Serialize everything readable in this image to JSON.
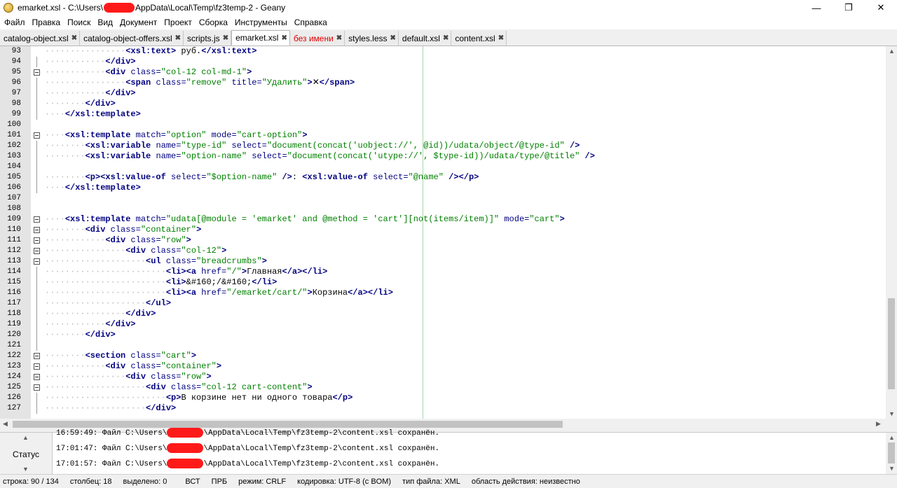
{
  "window": {
    "title_prefix": "emarket.xsl - C:\\Users\\",
    "title_suffix": "AppData\\Local\\Temp\\fz3temp-2 - Geany",
    "minimize": "—",
    "maximize": "❐",
    "close": "✕"
  },
  "menu": [
    "Файл",
    "Правка",
    "Поиск",
    "Вид",
    "Документ",
    "Проект",
    "Сборка",
    "Инструменты",
    "Справка"
  ],
  "tabs": [
    {
      "label": "catalog-object.xsl",
      "active": false,
      "unsaved": false
    },
    {
      "label": "catalog-object-offers.xsl",
      "active": false,
      "unsaved": false
    },
    {
      "label": "scripts.js",
      "active": false,
      "unsaved": false
    },
    {
      "label": "emarket.xsl",
      "active": true,
      "unsaved": false
    },
    {
      "label": "без имени",
      "active": false,
      "unsaved": true
    },
    {
      "label": "styles.less",
      "active": false,
      "unsaved": false
    },
    {
      "label": "default.xsl",
      "active": false,
      "unsaved": false
    },
    {
      "label": "content.xsl",
      "active": false,
      "unsaved": false
    }
  ],
  "editor": {
    "lines": [
      {
        "n": "93",
        "fold": "",
        "indent": 4,
        "code": [
          [
            "t",
            "<xsl:text>"
          ],
          [
            "x",
            " руб."
          ],
          [
            "t",
            "</xsl:text>"
          ]
        ]
      },
      {
        "n": "94",
        "fold": "line",
        "indent": 3,
        "code": [
          [
            "t",
            "</div>"
          ]
        ]
      },
      {
        "n": "95",
        "fold": "box",
        "indent": 3,
        "code": [
          [
            "t",
            "<div "
          ],
          [
            "a",
            "class="
          ],
          [
            "s",
            "\"col-12 col-md-1\""
          ],
          [
            "t",
            ">"
          ]
        ]
      },
      {
        "n": "96",
        "fold": "line",
        "indent": 4,
        "code": [
          [
            "t",
            "<span "
          ],
          [
            "a",
            "class="
          ],
          [
            "s",
            "\"remove\""
          ],
          [
            "a",
            " title="
          ],
          [
            "s",
            "\"Удалить\""
          ],
          [
            "t",
            ">"
          ],
          [
            "x",
            "✕"
          ],
          [
            "t",
            "</span>"
          ]
        ]
      },
      {
        "n": "97",
        "fold": "line",
        "indent": 3,
        "code": [
          [
            "t",
            "</div>"
          ]
        ]
      },
      {
        "n": "98",
        "fold": "line",
        "indent": 2,
        "code": [
          [
            "t",
            "</div>"
          ]
        ]
      },
      {
        "n": "99",
        "fold": "line",
        "indent": 1,
        "code": [
          [
            "t",
            "</xsl:template>"
          ]
        ]
      },
      {
        "n": "100",
        "fold": "",
        "indent": 0,
        "code": []
      },
      {
        "n": "101",
        "fold": "box",
        "indent": 1,
        "code": [
          [
            "t",
            "<xsl:template "
          ],
          [
            "a",
            "match="
          ],
          [
            "s",
            "\"option\""
          ],
          [
            "a",
            " mode="
          ],
          [
            "s",
            "\"cart-option\""
          ],
          [
            "t",
            ">"
          ]
        ]
      },
      {
        "n": "102",
        "fold": "line",
        "indent": 2,
        "code": [
          [
            "t",
            "<xsl:variable "
          ],
          [
            "a",
            "name="
          ],
          [
            "s",
            "\"type-id\""
          ],
          [
            "a",
            " select="
          ],
          [
            "s",
            "\"document(concat('uobject://', @id))/udata/object/@type-id\""
          ],
          [
            "t",
            " />"
          ]
        ]
      },
      {
        "n": "103",
        "fold": "line",
        "indent": 2,
        "code": [
          [
            "t",
            "<xsl:variable "
          ],
          [
            "a",
            "name="
          ],
          [
            "s",
            "\"option-name\""
          ],
          [
            "a",
            " select="
          ],
          [
            "s",
            "\"document(concat('utype://', $type-id))/udata/type/@title\""
          ],
          [
            "t",
            " />"
          ]
        ]
      },
      {
        "n": "104",
        "fold": "line",
        "indent": 0,
        "code": []
      },
      {
        "n": "105",
        "fold": "line",
        "indent": 2,
        "code": [
          [
            "t",
            "<p><xsl:value-of "
          ],
          [
            "a",
            "select="
          ],
          [
            "s",
            "\"$option-name\""
          ],
          [
            "t",
            " />"
          ],
          [
            "x",
            ": "
          ],
          [
            "t",
            "<xsl:value-of "
          ],
          [
            "a",
            "select="
          ],
          [
            "s",
            "\"@name\""
          ],
          [
            "t",
            " /></p>"
          ]
        ]
      },
      {
        "n": "106",
        "fold": "line",
        "indent": 1,
        "code": [
          [
            "t",
            "</xsl:template>"
          ]
        ]
      },
      {
        "n": "107",
        "fold": "",
        "indent": 0,
        "code": []
      },
      {
        "n": "108",
        "fold": "",
        "indent": 0,
        "code": []
      },
      {
        "n": "109",
        "fold": "box",
        "indent": 1,
        "code": [
          [
            "t",
            "<xsl:template "
          ],
          [
            "a",
            "match="
          ],
          [
            "s",
            "\"udata[@module = 'emarket' and @method = 'cart'][not(items/item)]\""
          ],
          [
            "a",
            " mode="
          ],
          [
            "s",
            "\"cart\""
          ],
          [
            "t",
            ">"
          ]
        ]
      },
      {
        "n": "110",
        "fold": "box",
        "indent": 2,
        "code": [
          [
            "t",
            "<div "
          ],
          [
            "a",
            "class="
          ],
          [
            "s",
            "\"container\""
          ],
          [
            "t",
            ">"
          ]
        ]
      },
      {
        "n": "111",
        "fold": "box",
        "indent": 3,
        "code": [
          [
            "t",
            "<div "
          ],
          [
            "a",
            "class="
          ],
          [
            "s",
            "\"row\""
          ],
          [
            "t",
            ">"
          ]
        ]
      },
      {
        "n": "112",
        "fold": "box",
        "indent": 4,
        "code": [
          [
            "t",
            "<div "
          ],
          [
            "a",
            "class="
          ],
          [
            "s",
            "\"col-12\""
          ],
          [
            "t",
            ">"
          ]
        ]
      },
      {
        "n": "113",
        "fold": "box",
        "indent": 5,
        "code": [
          [
            "t",
            "<ul "
          ],
          [
            "a",
            "class="
          ],
          [
            "s",
            "\"breadcrumbs\""
          ],
          [
            "t",
            ">"
          ]
        ]
      },
      {
        "n": "114",
        "fold": "line",
        "indent": 6,
        "code": [
          [
            "t",
            "<li><a "
          ],
          [
            "a",
            "href="
          ],
          [
            "s",
            "\"/\""
          ],
          [
            "t",
            ">"
          ],
          [
            "x",
            "Главная"
          ],
          [
            "t",
            "</a></li>"
          ]
        ]
      },
      {
        "n": "115",
        "fold": "line",
        "indent": 6,
        "code": [
          [
            "t",
            "<li>"
          ],
          [
            "x",
            "&#160;/&#160;"
          ],
          [
            "t",
            "</li>"
          ]
        ]
      },
      {
        "n": "116",
        "fold": "line",
        "indent": 6,
        "code": [
          [
            "t",
            "<li><a "
          ],
          [
            "a",
            "href="
          ],
          [
            "s",
            "\"/emarket/cart/\""
          ],
          [
            "t",
            ">"
          ],
          [
            "x",
            "Корзина"
          ],
          [
            "t",
            "</a></li>"
          ]
        ]
      },
      {
        "n": "117",
        "fold": "line",
        "indent": 5,
        "code": [
          [
            "t",
            "</ul>"
          ]
        ]
      },
      {
        "n": "118",
        "fold": "line",
        "indent": 4,
        "code": [
          [
            "t",
            "</div>"
          ]
        ]
      },
      {
        "n": "119",
        "fold": "line",
        "indent": 3,
        "code": [
          [
            "t",
            "</div>"
          ]
        ]
      },
      {
        "n": "120",
        "fold": "line",
        "indent": 2,
        "code": [
          [
            "t",
            "</div>"
          ]
        ]
      },
      {
        "n": "121",
        "fold": "line",
        "indent": 0,
        "code": []
      },
      {
        "n": "122",
        "fold": "box",
        "indent": 2,
        "code": [
          [
            "t",
            "<section "
          ],
          [
            "a",
            "class="
          ],
          [
            "s",
            "\"cart\""
          ],
          [
            "t",
            ">"
          ]
        ]
      },
      {
        "n": "123",
        "fold": "box",
        "indent": 3,
        "code": [
          [
            "t",
            "<div "
          ],
          [
            "a",
            "class="
          ],
          [
            "s",
            "\"container\""
          ],
          [
            "t",
            ">"
          ]
        ]
      },
      {
        "n": "124",
        "fold": "box",
        "indent": 4,
        "code": [
          [
            "t",
            "<div "
          ],
          [
            "a",
            "class="
          ],
          [
            "s",
            "\"row\""
          ],
          [
            "t",
            ">"
          ]
        ]
      },
      {
        "n": "125",
        "fold": "box",
        "indent": 5,
        "code": [
          [
            "t",
            "<div "
          ],
          [
            "a",
            "class="
          ],
          [
            "s",
            "\"col-12 cart-content\""
          ],
          [
            "t",
            ">"
          ]
        ]
      },
      {
        "n": "126",
        "fold": "line",
        "indent": 6,
        "code": [
          [
            "t",
            "<p>"
          ],
          [
            "x",
            "В корзине нет ни одного товара"
          ],
          [
            "t",
            "</p>"
          ]
        ]
      },
      {
        "n": "127",
        "fold": "line",
        "indent": 5,
        "code": [
          [
            "t",
            "</div>"
          ]
        ]
      }
    ]
  },
  "messages": {
    "tab_label": "Статус",
    "items": [
      {
        "prefix": "16:59:49: Файл C:\\Users\\",
        "suffix": "\\AppData\\Local\\Temp\\fz3temp-2\\content.xsl сохранён."
      },
      {
        "prefix": "17:01:47: Файл C:\\Users\\",
        "suffix": "\\AppData\\Local\\Temp\\fz3temp-2\\content.xsl сохранён."
      },
      {
        "prefix": "17:01:57: Файл C:\\Users\\",
        "suffix": "\\AppData\\Local\\Temp\\fz3temp-2\\content.xsl сохранён."
      }
    ]
  },
  "statusbar": {
    "line": "строка: 90 / 134",
    "column": "столбец: 18",
    "selected": "выделено: 0",
    "insert_mode": "ВСТ",
    "tab_mode": "ПРБ",
    "eol": "режим: CRLF",
    "encoding": "кодировка: UTF-8 (с BOM)",
    "filetype": "тип файла: XML",
    "scope": "область действия: неизвестно"
  },
  "colors": {
    "tag": "#000080",
    "string": "#008000",
    "unsaved_tab": "#e00000",
    "redaction": "#ff1a1a"
  }
}
